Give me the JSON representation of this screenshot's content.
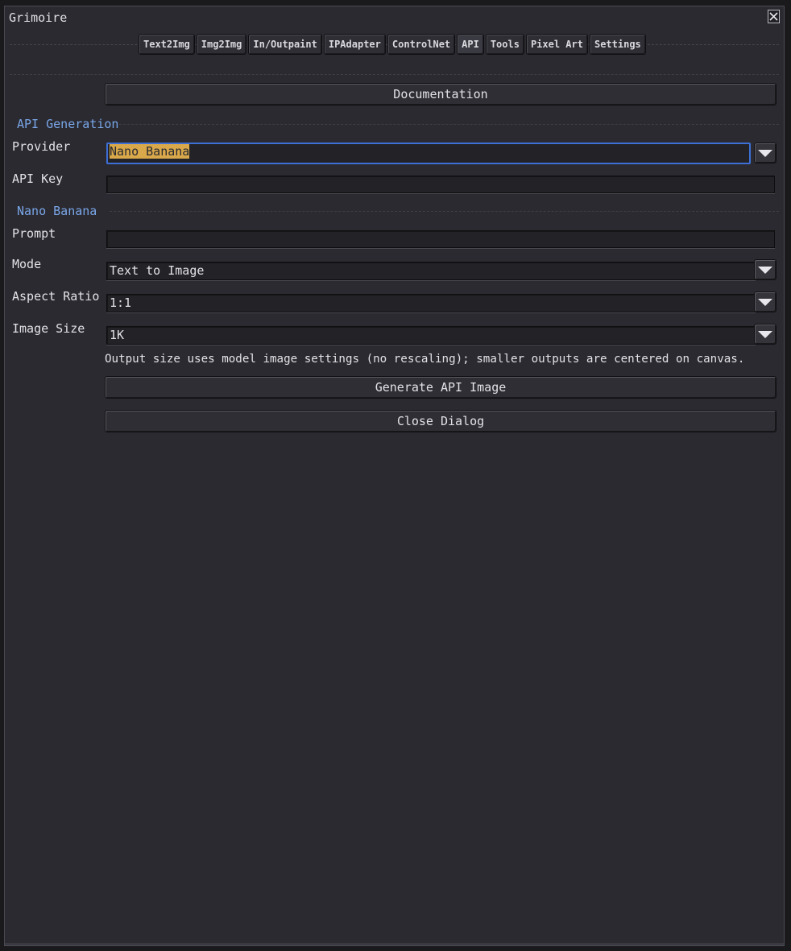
{
  "window": {
    "title": "Grimoire"
  },
  "tabs": [
    {
      "label": "Text2Img",
      "active": false
    },
    {
      "label": "Img2Img",
      "active": false
    },
    {
      "label": "In/Outpaint",
      "active": false
    },
    {
      "label": "IPAdapter",
      "active": false
    },
    {
      "label": "ControlNet",
      "active": false
    },
    {
      "label": "API",
      "active": true
    },
    {
      "label": "Tools",
      "active": false
    },
    {
      "label": "Pixel Art",
      "active": false
    },
    {
      "label": "Settings",
      "active": false
    }
  ],
  "documentation_button": "Documentation",
  "api_generation": {
    "section_title": "API Generation",
    "provider_label": "Provider",
    "provider_value": "Nano Banana",
    "api_key_label": "API Key",
    "api_key_value": ""
  },
  "nano_banana": {
    "section_title": "Nano Banana",
    "prompt_label": "Prompt",
    "prompt_value": "",
    "mode_label": "Mode",
    "mode_value": "Text to Image",
    "aspect_ratio_label": "Aspect Ratio",
    "aspect_ratio_value": "1:1",
    "image_size_label": "Image Size",
    "image_size_value": "1K"
  },
  "note": "Output size uses model image settings (no rescaling); smaller outputs are centered on canvas.",
  "generate_button": "Generate API Image",
  "close_dialog_button": "Close Dialog",
  "colors": {
    "accent_blue": "#7aa6e8",
    "focus_border": "#3d6fd6",
    "selection": "#d9a84a",
    "panel_bg": "#2a2a30"
  }
}
